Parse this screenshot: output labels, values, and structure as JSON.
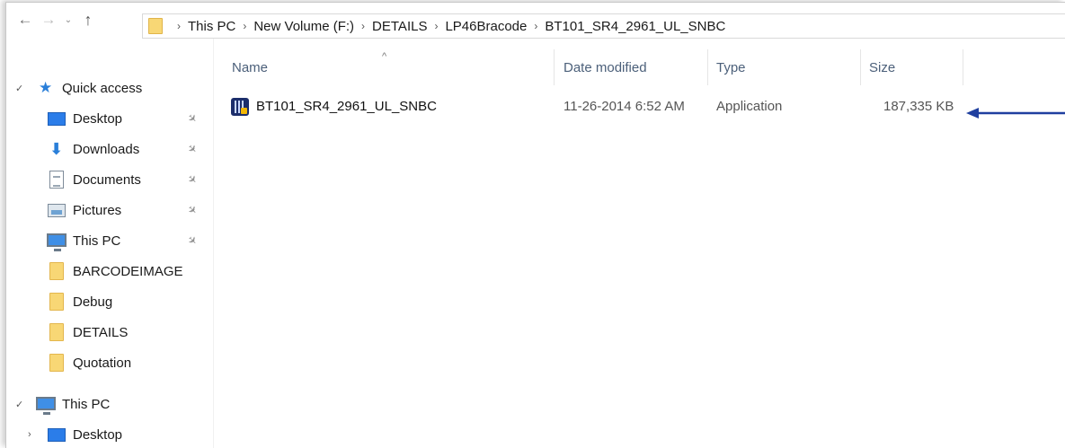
{
  "navigation": {
    "back_glyph": "←",
    "forward_glyph": "→",
    "recent_glyph": "⌄",
    "up_glyph": "↑"
  },
  "breadcrumb": [
    "This PC",
    "New Volume (F:)",
    "DETAILS",
    "LP46Bracode",
    "BT101_SR4_2961_UL_SNBC"
  ],
  "sidebar": {
    "quick_access_label": "Quick access",
    "items": [
      {
        "label": "Desktop",
        "icon": "desktop-icon",
        "pinned": true
      },
      {
        "label": "Downloads",
        "icon": "downloads-icon",
        "pinned": true
      },
      {
        "label": "Documents",
        "icon": "documents-icon",
        "pinned": true
      },
      {
        "label": "Pictures",
        "icon": "pictures-icon",
        "pinned": true
      },
      {
        "label": "This PC",
        "icon": "this-pc-icon",
        "pinned": true
      },
      {
        "label": "BARCODEIMAGE",
        "icon": "folder-icon",
        "pinned": false
      },
      {
        "label": "Debug",
        "icon": "folder-icon",
        "pinned": false
      },
      {
        "label": "DETAILS",
        "icon": "folder-icon",
        "pinned": false
      },
      {
        "label": "Quotation",
        "icon": "folder-icon",
        "pinned": false
      }
    ],
    "this_pc_label": "This PC",
    "this_pc_children": [
      {
        "label": "Desktop",
        "icon": "desktop-icon"
      }
    ]
  },
  "columns": {
    "name": "Name",
    "date_modified": "Date modified",
    "type": "Type",
    "size": "Size"
  },
  "files": [
    {
      "name": "BT101_SR4_2961_UL_SNBC",
      "date_modified": "11-26-2014 6:52 AM",
      "type": "Application",
      "size": "187,335 KB",
      "icon": "bartender-app-icon"
    }
  ],
  "colors": {
    "accent": "#2a7fd9",
    "header_text": "#4c607a",
    "annotation_arrow": "#1f3f9f",
    "folder": "#f8d775"
  }
}
